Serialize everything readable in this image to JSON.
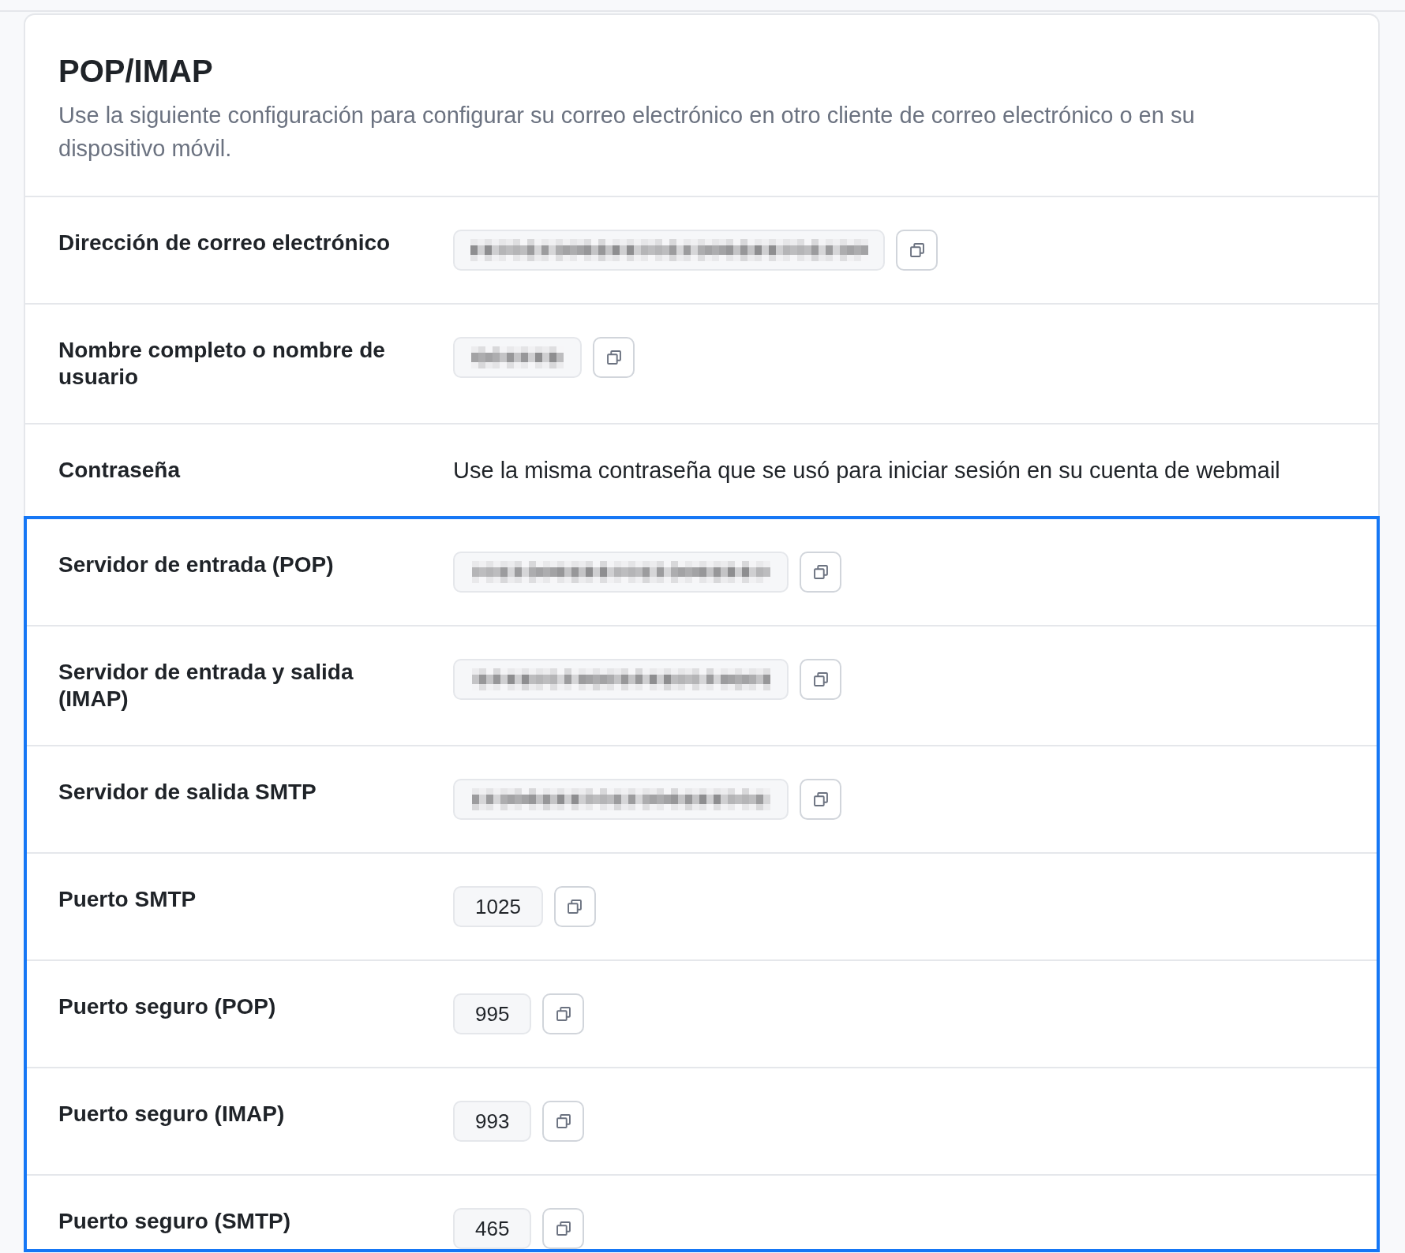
{
  "title": "POP/IMAP",
  "description": "Use la siguiente configuración para configurar su correo electrónico en otro cliente de correo electrónico o en su dispositivo móvil.",
  "sections": [
    {
      "highlighted": false,
      "rows": [
        {
          "label": "Dirección de correo electrónico",
          "kind": "redacted"
        },
        {
          "label": "Nombre completo o nombre de usuario",
          "kind": "redacted"
        },
        {
          "label": "Contraseña",
          "kind": "text",
          "text": "Use la misma contraseña que se usó para iniciar sesión en su cuenta de webmail"
        }
      ]
    },
    {
      "highlighted": true,
      "rows": [
        {
          "label": "Servidor de entrada (POP)",
          "kind": "redacted"
        },
        {
          "label": "Servidor de entrada y salida (IMAP)",
          "kind": "redacted"
        },
        {
          "label": "Servidor de salida SMTP",
          "kind": "redacted"
        },
        {
          "label": "Puerto SMTP",
          "kind": "field",
          "value": "1025"
        },
        {
          "label": "Puerto seguro (POP)",
          "kind": "field",
          "value": "995"
        },
        {
          "label": "Puerto seguro (IMAP)",
          "kind": "field",
          "value": "993"
        },
        {
          "label": "Puerto seguro (SMTP)",
          "kind": "field",
          "value": "465"
        }
      ]
    }
  ]
}
